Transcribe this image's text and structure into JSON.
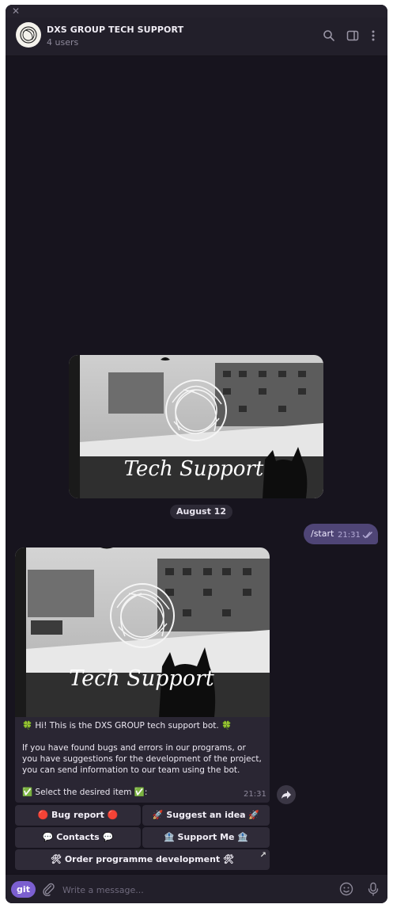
{
  "window": {
    "close_glyph": "✕"
  },
  "header": {
    "title": "DXS GROUP TECH SUPPORT",
    "subtitle": "4 users",
    "icons": [
      "search-icon",
      "sidebar-toggle-icon",
      "more-vertical-icon"
    ]
  },
  "photo_caption": "Tech Support",
  "date_separator": "August 12",
  "outgoing": {
    "text": "/start",
    "time": "21:31",
    "status": "read"
  },
  "incoming": {
    "text": "🍀 Hi! This is the DXS GROUP tech support bot. 🍀\n\nIf you have found bugs and errors in our programs, or you have suggestions for the development of the project, you can send information to our team using the bot.\n\n✅ Select the desired item ✅:",
    "time": "21:31"
  },
  "keyboard": {
    "bug_report": "🔴 Bug report 🔴",
    "suggest_idea": "🚀 Suggest an idea 🚀",
    "contacts": "💬 Contacts 💬",
    "support_me": "🏦 Support Me 🏦",
    "order_development": "🛠 Order programme development 🛠",
    "order_link_glyph": "↗"
  },
  "composer": {
    "git_label": "git",
    "placeholder": "Write a message..."
  },
  "colors": {
    "background": "#17141e",
    "header": "#221f2a",
    "outgoing_bubble": "#4f4576",
    "incoming_bubble": "#2a2633",
    "accent": "#7b5fd0"
  }
}
